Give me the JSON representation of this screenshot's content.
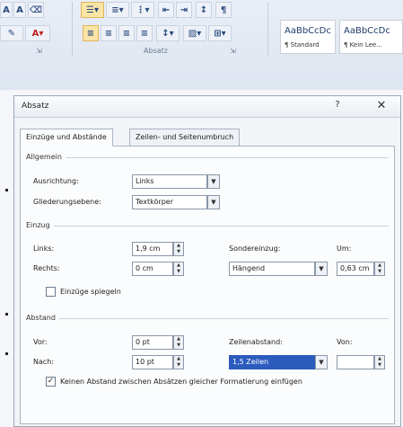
{
  "ribbon": {
    "group_label": "Absatz",
    "styles": [
      {
        "sample": "AaBbCcDc",
        "name": "¶ Standard"
      },
      {
        "sample": "AaBbCcDc",
        "name": "¶ Kein Lee..."
      }
    ]
  },
  "dialog": {
    "title": "Absatz",
    "help": "?",
    "close": "✕",
    "tabs": [
      {
        "label": "Einzüge und Abstände"
      },
      {
        "label": "Zeilen- und Seitenumbruch"
      }
    ],
    "allgemein": {
      "title": "Allgemein",
      "ausrichtung_label": "Ausrichtung:",
      "ausrichtung_value": "Links",
      "gliederung_label": "Gliederungsebene:",
      "gliederung_value": "Textkörper"
    },
    "einzug": {
      "title": "Einzug",
      "links_label": "Links:",
      "links_value": "1,9 cm",
      "rechts_label": "Rechts:",
      "rechts_value": "0 cm",
      "sondereinzug_label": "Sondereinzug:",
      "sondereinzug_value": "Hängend",
      "um_label": "Um:",
      "um_value": "0,63 cm",
      "spiegeln_label": "Einzüge spiegeln"
    },
    "abstand": {
      "title": "Abstand",
      "vor_label": "Vor:",
      "vor_value": "0 pt",
      "nach_label": "Nach:",
      "nach_value": "10 pt",
      "zeilenabstand_label": "Zeilenabstand:",
      "zeilenabstand_value": "1,5 Zeilen",
      "von_label": "Von:",
      "von_value": "",
      "keinen_abstand_label": "Keinen Abstand zwischen Absätzen gleicher Formatierung einfügen",
      "keinen_abstand_checked": true
    }
  }
}
